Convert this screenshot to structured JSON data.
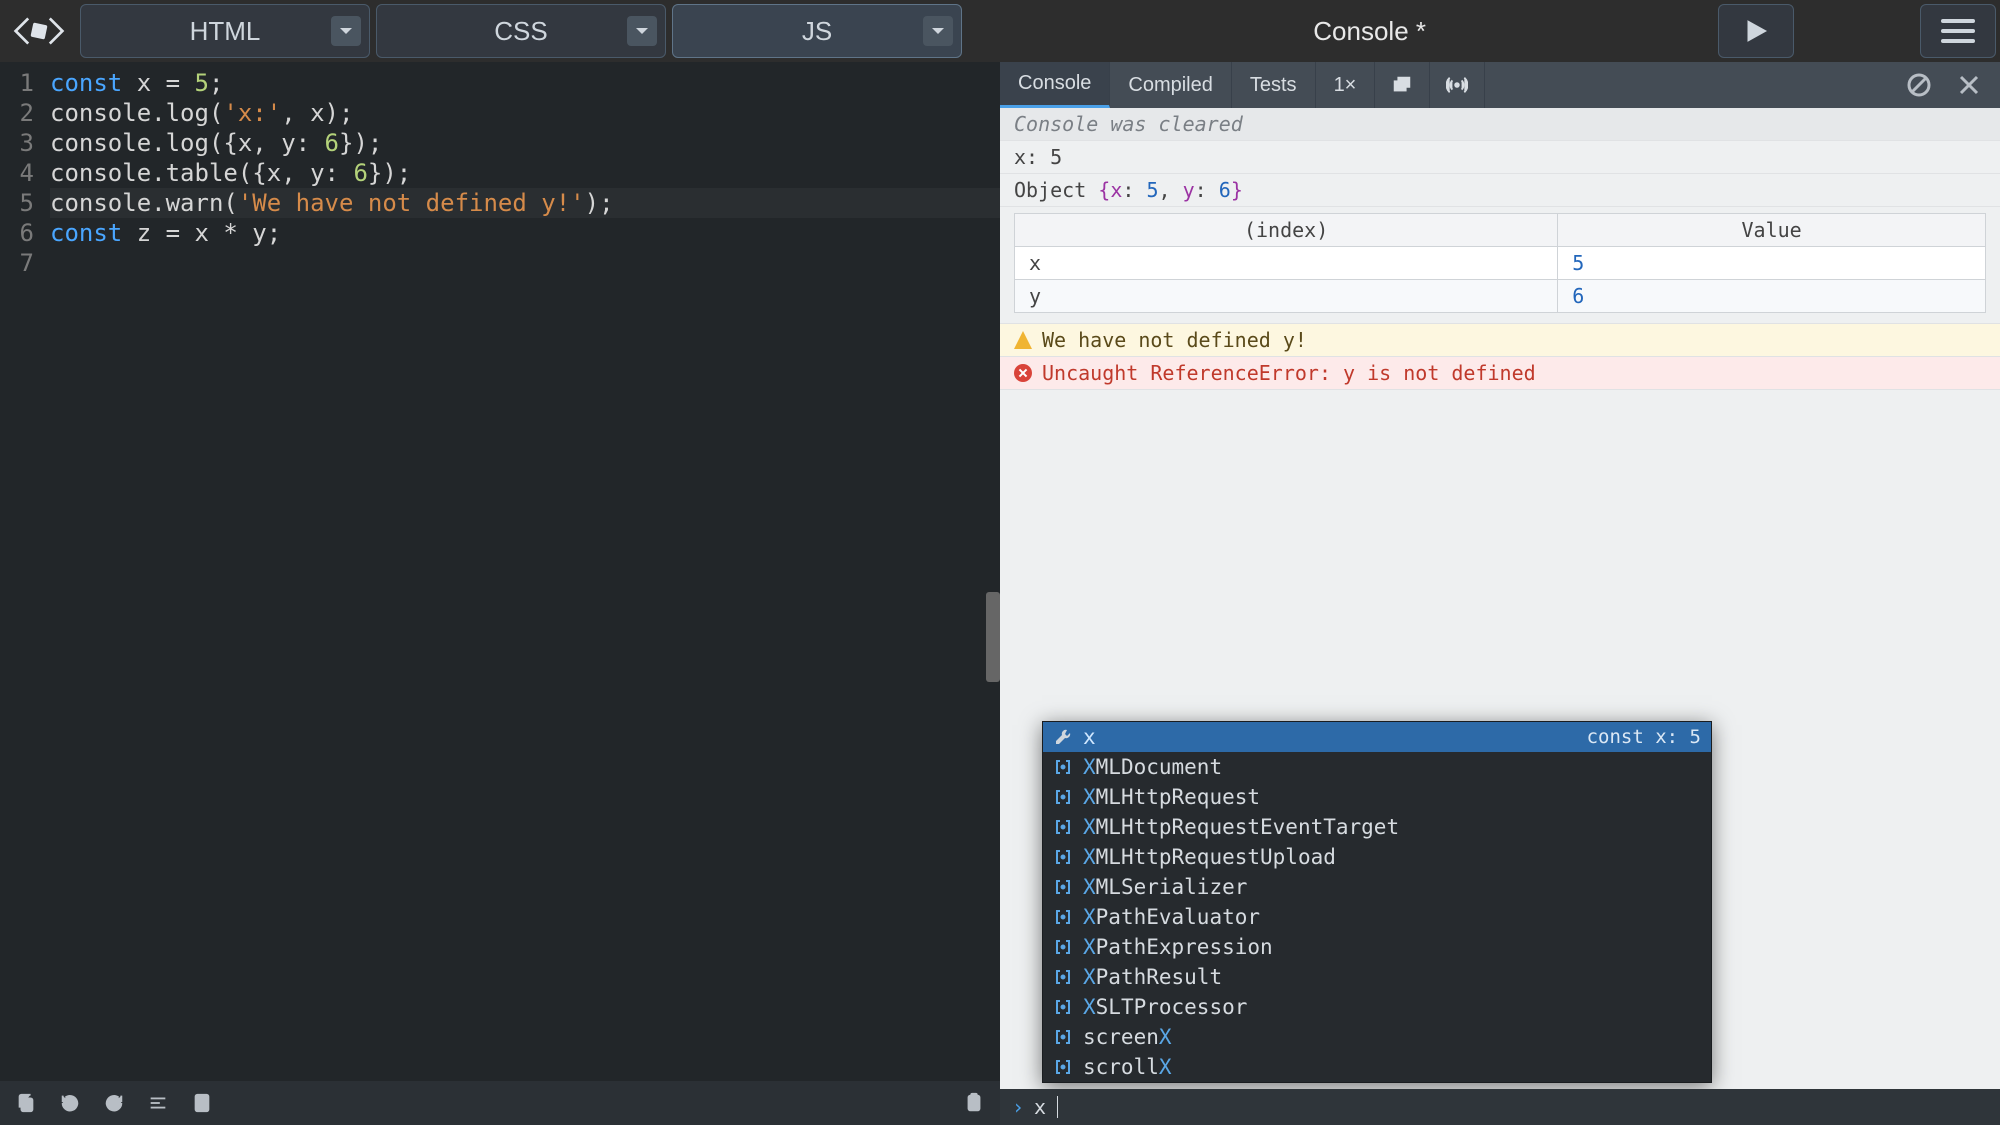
{
  "tabs": {
    "html": "HTML",
    "css": "CSS",
    "js": "JS"
  },
  "title": "Console  *",
  "code_lines": [
    {
      "n": "1",
      "html": "<span class='kw'>const</span> x = <span class='num'>5</span>;"
    },
    {
      "n": "2",
      "html": "console.log(<span class='str'>'x:'</span>, x);"
    },
    {
      "n": "3",
      "html": "console.log({x, <span>y</span>: <span class='num'>6</span>});"
    },
    {
      "n": "4",
      "html": "console.table({x, <span>y</span>: <span class='num'>6</span>});"
    },
    {
      "n": "5",
      "html": "console.warn(<span class='str'>'We have not defined y!'</span>);"
    },
    {
      "n": "6",
      "html": "<span class='kw'>const</span> z = x * y;"
    },
    {
      "n": "7",
      "html": ""
    }
  ],
  "right_tabs": {
    "console": "Console",
    "compiled": "Compiled",
    "tests": "Tests",
    "scale": "1×"
  },
  "console": {
    "cleared": "Console was cleared",
    "line_x": "x: 5",
    "obj_prefix": "Object ",
    "obj_open": "{",
    "obj_k1": "x",
    "obj_v1": "5",
    "obj_k2": "y",
    "obj_v2": "6",
    "obj_close": "}",
    "table": {
      "h1": "(index)",
      "h2": "Value",
      "rows": [
        {
          "k": "x",
          "v": "5"
        },
        {
          "k": "y",
          "v": "6"
        }
      ]
    },
    "warn": "We have not defined y!",
    "err": "Uncaught ReferenceError: y is not defined"
  },
  "autocomplete": {
    "hint": "const x: 5",
    "items": [
      {
        "match": "x",
        "rest": "",
        "type": "wrench",
        "selected": true
      },
      {
        "match": "X",
        "rest": "MLDocument",
        "type": "bracket"
      },
      {
        "match": "X",
        "rest": "MLHttpRequest",
        "type": "bracket"
      },
      {
        "match": "X",
        "rest": "MLHttpRequestEventTarget",
        "type": "bracket"
      },
      {
        "match": "X",
        "rest": "MLHttpRequestUpload",
        "type": "bracket"
      },
      {
        "match": "X",
        "rest": "MLSerializer",
        "type": "bracket"
      },
      {
        "match": "X",
        "rest": "PathEvaluator",
        "type": "bracket"
      },
      {
        "match": "X",
        "rest": "PathExpression",
        "type": "bracket"
      },
      {
        "match": "X",
        "rest": "PathResult",
        "type": "bracket"
      },
      {
        "match": "X",
        "rest": "SLTProcessor",
        "type": "bracket"
      },
      {
        "match": "X",
        "rest": "",
        "prefix": "screen",
        "type": "bracket"
      },
      {
        "match": "X",
        "rest": "",
        "prefix": "scroll",
        "type": "bracket"
      }
    ]
  },
  "input_value": "x"
}
